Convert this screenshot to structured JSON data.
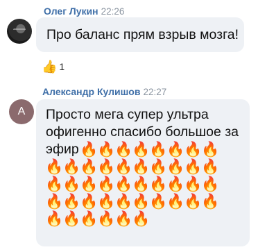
{
  "messages": [
    {
      "sender": "Олег Лукин",
      "time": "22:26",
      "text": "Про баланс прям взрыв мозга!",
      "reaction": {
        "icon": "thumbs-up",
        "glyph": "👍",
        "count": "1"
      }
    },
    {
      "sender": "Александр Кулишов",
      "time": "22:27",
      "avatar_letter": "A",
      "avatar_color": "#8b6a6d",
      "lines": [
        "Просто мега супер ультра",
        "офигенно спасибо большое за",
        "эфир"
      ],
      "fire_glyph": "🔥",
      "fire_count": 44
    }
  ],
  "colors": {
    "sender_name": "#3f6fa8",
    "bubble_bg": "#eef1f5",
    "time": "#8b95a1"
  }
}
